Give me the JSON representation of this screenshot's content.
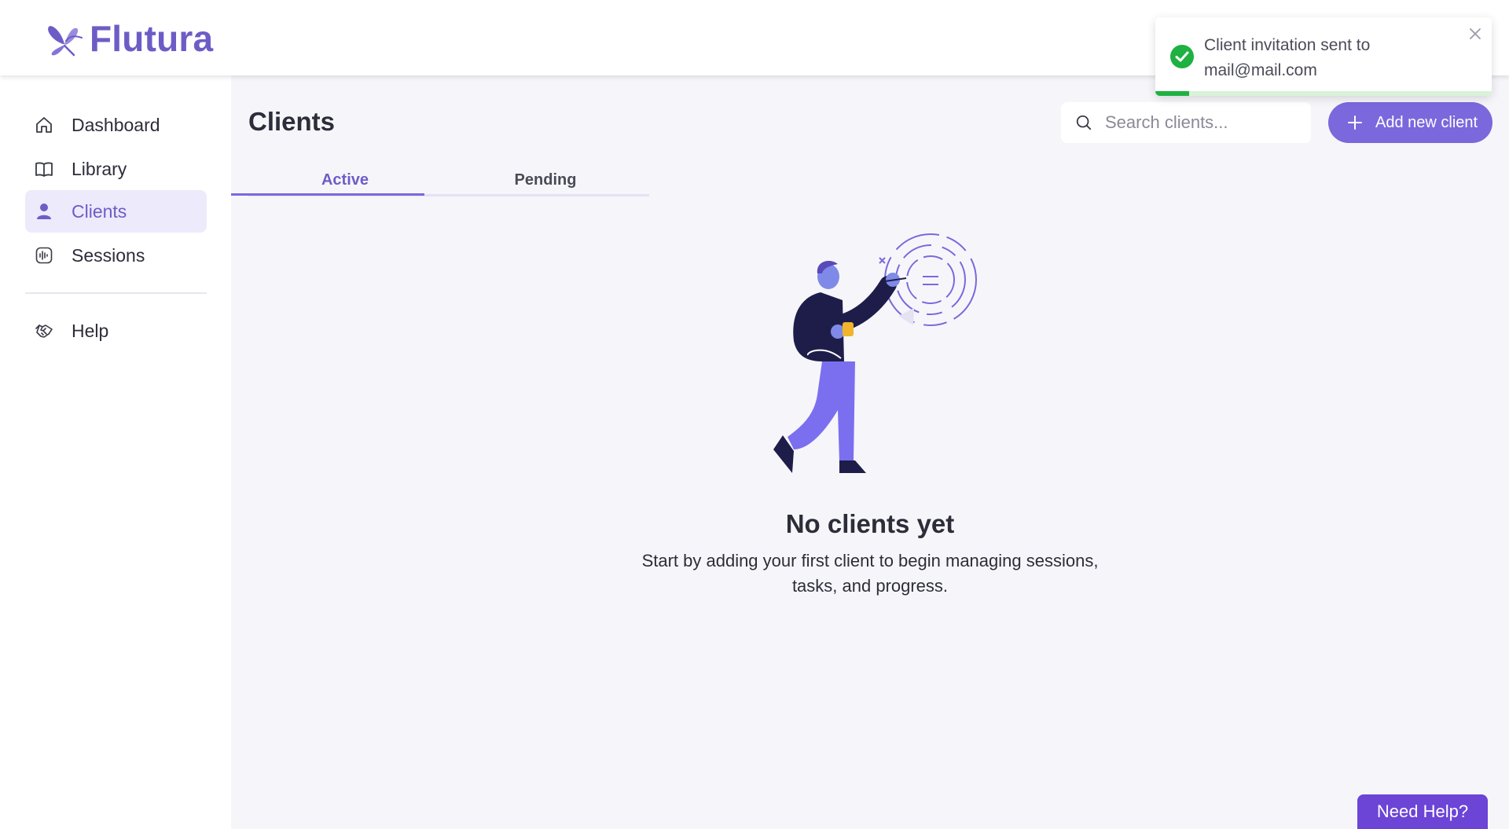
{
  "app": {
    "name": "Flutura",
    "brand_color": "#6e5cc6"
  },
  "sidebar": {
    "items": [
      {
        "label": "Dashboard",
        "icon": "home-icon",
        "active": false
      },
      {
        "label": "Library",
        "icon": "book-icon",
        "active": false
      },
      {
        "label": "Clients",
        "icon": "user-icon",
        "active": true
      },
      {
        "label": "Sessions",
        "icon": "audio-wave-icon",
        "active": false
      },
      {
        "label": "Help",
        "icon": "handshake-icon",
        "active": false
      }
    ]
  },
  "main": {
    "title": "Clients",
    "search": {
      "placeholder": "Search clients...",
      "value": ""
    },
    "add_button_label": "Add new client",
    "tabs": [
      {
        "label": "Active",
        "active": true
      },
      {
        "label": "Pending",
        "active": false
      }
    ],
    "empty_state": {
      "title": "No clients yet",
      "description": "Start by adding your first client to begin managing sessions, tasks, and progress."
    }
  },
  "toast": {
    "message": "Client invitation sent to mail@mail.com",
    "status_color": "#1fb141",
    "progress": 0.1
  },
  "help_button_label": "Need Help?"
}
